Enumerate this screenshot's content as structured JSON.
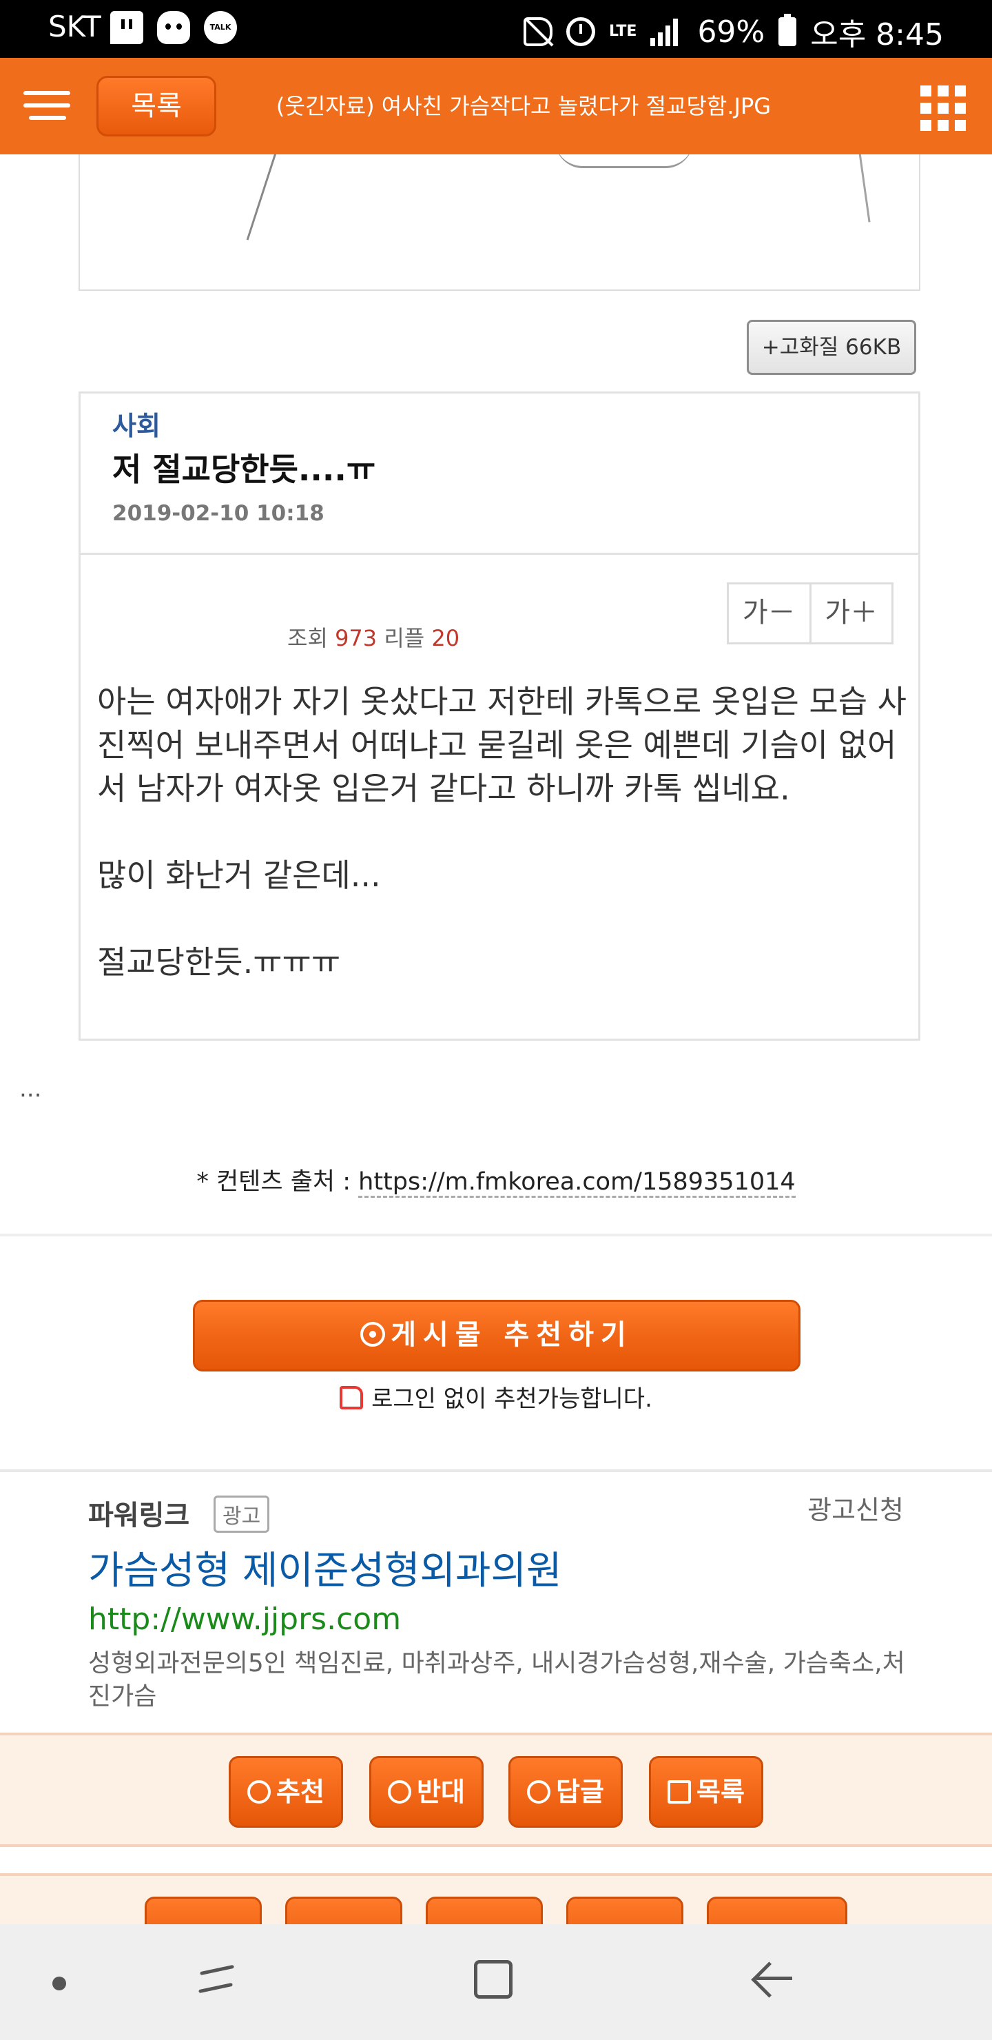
{
  "status_bar": {
    "carrier": "SKT",
    "lte": "LTE",
    "battery": "69%",
    "time": "오후 8:45",
    "left_icons": [
      "twitch-icon",
      "discord-icon",
      "kakaotalk-icon"
    ],
    "kakaotalk_label": "TALK",
    "right_icons": [
      "mute-icon",
      "alarm-icon",
      "signal-icon",
      "battery-icon"
    ]
  },
  "header": {
    "list_button": "목록",
    "title": "(웃긴자료) 여사친 가슴작다고 놀렸다가 절교당함.JPG",
    "accent_color": "#ef6d1b"
  },
  "image": {
    "hq_button": "+고화질 66KB"
  },
  "post": {
    "category": "사회",
    "title": "저 절교당한듯....ㅠ",
    "date": "2019-02-10 10:18",
    "font_smaller": "가－",
    "font_larger": "가＋",
    "views_label": "조회",
    "views": "973",
    "replies_label": "리플",
    "replies": "20",
    "paragraphs": [
      "아는 여자애가 자기 옷샀다고 저한테 카톡으로 옷입은 모습 사진찍어 보내주면서 어떠냐고 묻길레 옷은 예쁜데 기슴이 없어서 남자가 여자옷 입은거 같다고 하니까 카톡 씹네요.",
      "많이 화난거 같은데...",
      "절교당한듯.ㅠㅠㅠ"
    ]
  },
  "ellipsis": "...",
  "source": {
    "label": "* 컨텐츠 출처 : ",
    "url": "https://m.fmkorea.com/1589351014"
  },
  "recommend": {
    "button": "게시물 추천하기",
    "note": "로그인 없이 추천가능합니다."
  },
  "ad": {
    "power_link": "파워링크",
    "tag": "광고",
    "apply": "광고신청",
    "title": "가슴성형 제이준성형외과의원",
    "url": "http://www.jjprs.com",
    "description": "성형외과전문의5인 책임진료, 마취과상주, 내시경가슴성형,재수술, 가슴축소,처진가슴"
  },
  "actions": {
    "recommend": "추천",
    "oppose": "반대",
    "reply": "답글",
    "list": "목록"
  },
  "navbar": {
    "icons": [
      "nav-dot-icon",
      "recent-apps-icon",
      "home-icon",
      "back-icon"
    ]
  }
}
